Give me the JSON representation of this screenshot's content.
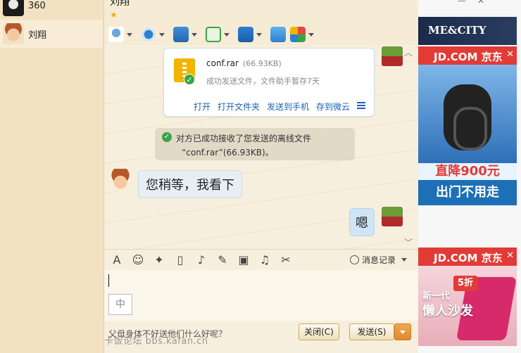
{
  "sidebar": {
    "contacts": [
      {
        "name": "360"
      },
      {
        "name": "刘翔"
      }
    ]
  },
  "chat": {
    "title": "刘翔",
    "toolbar_icons": [
      "voice-icon",
      "video-icon",
      "file-transfer-icon",
      "group-add-icon",
      "screen-share-icon",
      "remote-assist-icon",
      "apps-icon"
    ],
    "file_card": {
      "filename": "conf.rar",
      "size": "(66.93KB)",
      "status": "成功发送文件，文件助手暂存7天",
      "actions": [
        "打开",
        "打开文件夹",
        "发送到手机",
        "存到微云"
      ]
    },
    "notice": {
      "line1": "对方已成功接收了您发送的离线文件",
      "line2": "“conf.rar”(66.93KB)。"
    },
    "messages": [
      {
        "from": "other",
        "text": "您稍等，我看下"
      },
      {
        "from": "self",
        "text": "嗯"
      }
    ],
    "input_toolbar": {
      "icons": [
        "font-icon",
        "emoji-icon",
        "magic-icon",
        "shake-icon",
        "voice-msg-icon",
        "edit-icon",
        "image-icon",
        "music-icon",
        "screenshot-icon"
      ],
      "history_label": "消息记录"
    },
    "input": {
      "ime_indicator": "中"
    },
    "footer": {
      "hint": "父母身体不好送他们什么好呢？",
      "close_label": "关闭(C)",
      "send_label": "发送(S)"
    },
    "watermark": "卡饭论坛 bbs.kafan.cn"
  },
  "ads": {
    "top": "ME&CITY",
    "jd1": {
      "brand": "JD.COM 京东",
      "price": "直降900元",
      "slogan": "出门不用走"
    },
    "jd2": {
      "brand": "JD.COM 京东",
      "badge": "5折",
      "line1": "新一代",
      "line2": "懒人沙发"
    },
    "close_x": "✕"
  }
}
